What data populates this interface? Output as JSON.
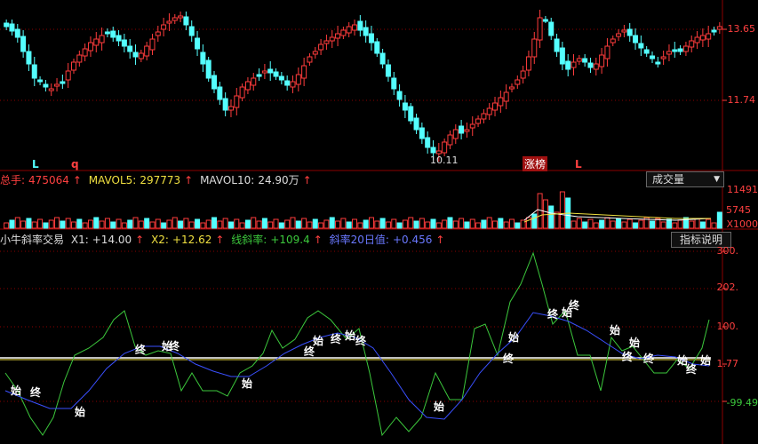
{
  "colors": {
    "up": "#ff3c3c",
    "down": "#54ffff",
    "grid": "#8b0000",
    "green": "#3cc83c",
    "blue": "#3a50ff",
    "yellow": "#f0e040",
    "white": "#ffffff"
  },
  "price_panel": {
    "y_labels": [
      "13.65",
      "11.74"
    ],
    "marks": {
      "left_L": "L",
      "left_q": "q",
      "date_marker": "10.11",
      "zhangbang": "涨榜",
      "right_L": "L"
    }
  },
  "volume_panel": {
    "header": {
      "total_hand_label": "总手:",
      "total_hand_value": "475064",
      "mavol5_label": "MAVOL5:",
      "mavol5_value": "297773",
      "mavol10_label": "MAVOL10:",
      "mavol10_value": "24.90万"
    },
    "dropdown_label": "成交量",
    "y_labels": [
      "11491",
      "5745",
      "X1000"
    ]
  },
  "indicator_panel": {
    "header": {
      "name": "小牛斜率交易",
      "x1_label": "X1:",
      "x1_value": "+14.00",
      "x2_label": "X2:",
      "x2_value": "+12.62",
      "slope_label": "线斜率:",
      "slope_value": "+109.4",
      "slope20_label": "斜率20日值:",
      "slope20_value": "+0.456"
    },
    "help_button": "指标说明",
    "y_labels": [
      "300.",
      "202.",
      "100.",
      "1.77",
      "-99.49"
    ],
    "signal_start": "始",
    "signal_end": "终"
  },
  "chart_data": [
    {
      "type": "candlestick",
      "title": "",
      "y_axis_ticks": [
        13.65,
        11.74
      ],
      "ohlc_summary": "daily candles ranging roughly from 10.9 to 14.3"
    },
    {
      "type": "bar",
      "title": "成交量",
      "y_axis_ticks": [
        11491,
        5745
      ],
      "unit": "X1000"
    },
    {
      "type": "line",
      "title": "小牛斜率交易",
      "y_axis_ticks": [
        300,
        202,
        100,
        1.77,
        -99.49
      ],
      "series": [
        {
          "name": "线斜率"
        },
        {
          "name": "斜率20日值"
        }
      ]
    }
  ]
}
